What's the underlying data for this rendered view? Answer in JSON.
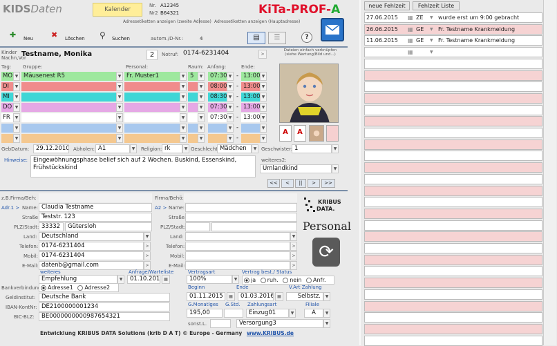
{
  "header": {
    "logo_a": "KIDS",
    "logo_b": "Daten",
    "calendar": "Kalender",
    "nr_label": "Nr.",
    "nr": "A12345",
    "nr2_label": "Nr2",
    "nr2": "B64321",
    "addr_left": "Adressetiketten anzeigen (zweite Adresse)",
    "addr_right": "Adressetiketten anzeigen (Hauptadresse)",
    "brand": "KiTa-PROF-",
    "brand_a": "A"
  },
  "toolbar": {
    "new": "Neu",
    "delete": "Löschen",
    "search": "Suchen",
    "autom": "autom./D-Nr.:",
    "count": "4"
  },
  "child": {
    "label_a": "Kinder",
    "label_b": "Nachn,Vor",
    "name": "Testname, Monika",
    "num": "2",
    "notruf_label": "Notruf:",
    "notruf": "0174-6231404",
    "photo_hint": "Dateien einfach verknüpfen (siehe Wartung/Bild und...)"
  },
  "schedule": {
    "h_tag": "Tag:",
    "h_gruppe": "Gruppe:",
    "h_personal": "Personal:",
    "h_raum": "Raum:",
    "h_anfang": "Anfang:",
    "h_ende": "Ende:",
    "dash": "-",
    "days": [
      {
        "day": "MO",
        "group": "Mäusenest R5",
        "personal": "Fr. Muster1",
        "raum": "5",
        "start": "07:30",
        "end": "13:00",
        "color": "#9ee89e"
      },
      {
        "day": "DI",
        "group": "",
        "personal": "",
        "raum": "",
        "start": "08:00",
        "end": "13:00",
        "color": "#f08c8c"
      },
      {
        "day": "MI",
        "group": "",
        "personal": "",
        "raum": "",
        "start": "08:30",
        "end": "13:00",
        "color": "#3fd6d6"
      },
      {
        "day": "DO",
        "group": "",
        "personal": "",
        "raum": "",
        "start": "07:30",
        "end": "13:00",
        "color": "#e5a8e5"
      },
      {
        "day": "FR",
        "group": "",
        "personal": "",
        "raum": "",
        "start": "07:30",
        "end": "13:00",
        "color": "#ffffff"
      },
      {
        "day": "",
        "group": "",
        "personal": "",
        "raum": "",
        "start": "",
        "end": "",
        "color": "#a8c8ee"
      },
      {
        "day": "",
        "group": "",
        "personal": "",
        "raum": "",
        "start": "",
        "end": "",
        "color": "#f4c890"
      }
    ]
  },
  "details": {
    "geb_label": "GebDatum:",
    "geb": "29.12.2010",
    "abholen_label": "Abholen:",
    "abholen": "A1",
    "religion_label": "Religion:",
    "religion": "rk",
    "geschlecht_label": "Geschlecht:",
    "geschlecht": "Mädchen",
    "geschwister_label": "Geschwister:",
    "geschwister": "1",
    "hinweis_label": "Hinweise:",
    "hinweis": "Eingewöhnungsphase belief sich auf 2 Wochen. Buskind, Essenskind, Frühstückskind",
    "weiteres_label": "weiteres2:",
    "weiteres": "Umlandkind"
  },
  "nav": {
    "first": "<<",
    "prev": "<",
    "mid": "||",
    "next": ">",
    "last": ">>"
  },
  "address": {
    "firma_label": "z.B.Firma/Beh:",
    "firma2_label": "Firma/Behö:",
    "adr1": "Adr.1 >",
    "name_label": "Name:",
    "name": "Claudia Testname",
    "a2": "A2 >",
    "name2_label": "Name:",
    "strasse_label": "Straße:",
    "strasse": "Teststr. 123",
    "strasse2_label": "Straße:",
    "plz_label": "PLZ/Stadt:",
    "plz": "33332",
    "stadt": "Gütersloh",
    "plz2_label": "PLZ/Stadt:",
    "land_label": "Land:",
    "land": "Deutschland",
    "land2_label": "Land:",
    "tel_label": "Telefon:",
    "tel": "0174-6231404",
    "tel2_label": "Telefon:",
    "mobil_label": "Mobil:",
    "mobil": "0174-6231404",
    "mobil2_label": "Mobil:",
    "email_label": "E-Mail:",
    "email": "datenb@gmail.com",
    "email2_label": "E-Mail:"
  },
  "contract": {
    "weiteres_label": "weiteres",
    "weiteres": "Empfehlung",
    "anfrage_label": "Anfrage/Warteliste",
    "anfrage": "01.10.2013",
    "vertragsart_label": "Vertragsart",
    "vertragsart": "100%",
    "vertrag_status_label": "Vertrag best./ Status",
    "opt_ja": "ja",
    "opt_ruh": "ruh.",
    "opt_nein": "nein",
    "opt_anfr": "Anfr.",
    "beginn_label": "Beginn",
    "beginn": "01.11.2015",
    "ende_label": "Ende",
    "ende": "01.03.2016",
    "zahlung_label": "V.Art Zahlung",
    "zahlung": "Selbstz.",
    "gmonat_label": "G.Monatlges",
    "gmonat": "195,00",
    "gstd_label": "G.Std.",
    "zahlungsart_label": "Zahlungsart",
    "zahlungsart": "Einzug01",
    "filiale_label": "Filiale",
    "filiale": "A",
    "sonst_label": "sonst.L.",
    "sonst": "Versorgung3"
  },
  "bank": {
    "verb_label": "Bankverbindung:",
    "adr1": "Adresse1",
    "adr2": "Adresse2",
    "inst_label": "Geldinstitut:",
    "inst": "Deutsche Bank",
    "iban_label": "IBAN-KontNr:",
    "iban": "DE2100000001234",
    "bic_label": "BIC-BLZ:",
    "bic": "BE0000000000987654321"
  },
  "right": {
    "kribus": "KRIBUS",
    "kribus_data": "DATA.",
    "personal": "Personal"
  },
  "footer": {
    "text": "Entwicklung KRIBUS DATA Solutions (krib D A T) © Europe - Germany",
    "link": "www.KRIBUS.de"
  },
  "panel": {
    "tab1": "neue Fehlzeit",
    "tab2": "Fehlzeit Liste",
    "rows": [
      {
        "date": "27.06.2015",
        "code": "ZE",
        "note": "wurde erst um 9:00 gebracht",
        "bg": "#ffffff"
      },
      {
        "date": "26.06.2015",
        "code": "GE",
        "note": "Fr. Testname Krankmeldung",
        "bg": "#f6d3d3"
      },
      {
        "date": "11.06.2015",
        "code": "GE",
        "note": "Fr. Testname Krankmeldung",
        "bg": "#ffffff"
      },
      {
        "date": "",
        "code": "",
        "note": "",
        "bg": "#ffffff"
      }
    ]
  },
  "colors": {
    "accent_blue": "#2255aa",
    "brand_red": "#e0102a",
    "alt_row": "#f6d3d3"
  }
}
